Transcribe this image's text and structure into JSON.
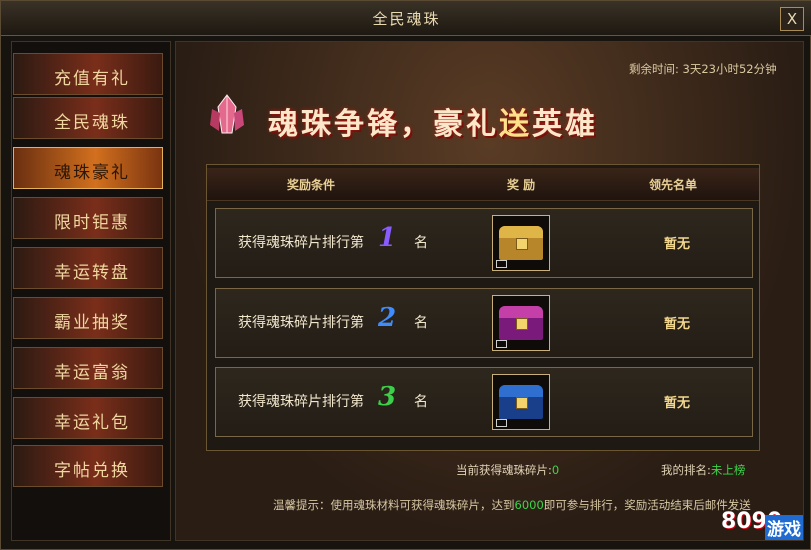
{
  "window": {
    "title": "全民魂珠",
    "close_label": "X"
  },
  "sidebar": {
    "items": [
      {
        "label": "充值有礼",
        "active": false
      },
      {
        "label": "全民魂珠",
        "active": false
      },
      {
        "label": "魂珠豪礼",
        "active": true
      },
      {
        "label": "限时钜惠",
        "active": false
      },
      {
        "label": "幸运转盘",
        "active": false
      },
      {
        "label": "霸业抽奖",
        "active": false
      },
      {
        "label": "幸运富翁",
        "active": false
      },
      {
        "label": "幸运礼包",
        "active": false
      },
      {
        "label": "字帖兑换",
        "active": false
      }
    ]
  },
  "main": {
    "remaining_label": "剩余时间: ",
    "remaining_value": "3天23小时52分钟",
    "banner": {
      "part1": "魂珠争锋，豪礼",
      "part2": "送",
      "part3": "英雄"
    },
    "table": {
      "headers": {
        "condition": "奖励条件",
        "reward": "奖 励",
        "leader": "领先名单"
      },
      "rows": [
        {
          "prefix": "获得魂珠碎片排行第",
          "rank": "1",
          "suffix": "名",
          "leader": "暂无",
          "rank_color": "#8a5cff",
          "chest_color": "#b8862a",
          "chest_lid": "#e0b548"
        },
        {
          "prefix": "获得魂珠碎片排行第",
          "rank": "2",
          "suffix": "名",
          "leader": "暂无",
          "rank_color": "#3f8cff",
          "chest_color": "#7a1a7a",
          "chest_lid": "#c53fa8"
        },
        {
          "prefix": "获得魂珠碎片排行第",
          "rank": "3",
          "suffix": "名",
          "leader": "暂无",
          "rank_color": "#3ccf4a",
          "chest_color": "#1a3f8a",
          "chest_lid": "#2f6fd0"
        }
      ]
    },
    "fragments_label": "当前获得魂珠碎片:",
    "fragments_value": "0",
    "my_rank_label": "我的排名:",
    "my_rank_value": "未上榜",
    "tip_prefix": "温馨提示：使用魂珠材料可获得魂珠碎片，达到",
    "tip_threshold": "6000",
    "tip_suffix": "即可参与排行，奖励活动结束后邮件发送"
  },
  "watermark": {
    "number": "8090",
    "text": "游戏"
  }
}
